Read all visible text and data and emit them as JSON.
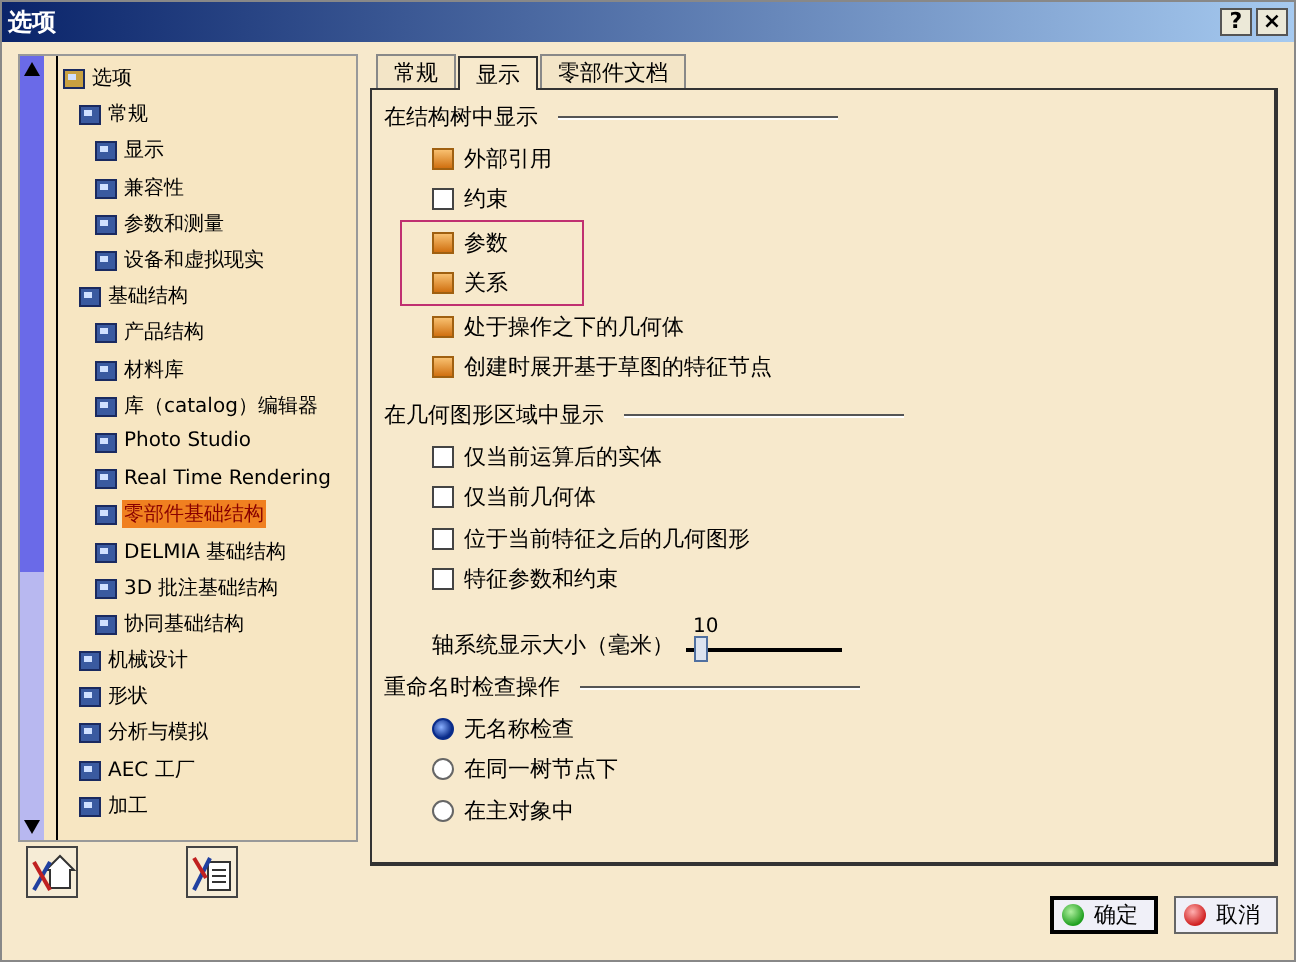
{
  "window": {
    "title": "选项",
    "help_button": "?",
    "close_button": "×"
  },
  "tree": [
    {
      "label": "选项",
      "selected": false,
      "children": [
        {
          "label": "常规",
          "selected": false,
          "children": [
            {
              "label": "显示",
              "selected": false
            },
            {
              "label": "兼容性",
              "selected": false
            },
            {
              "label": "参数和测量",
              "selected": false
            },
            {
              "label": "设备和虚拟现实",
              "selected": false
            }
          ]
        },
        {
          "label": "基础结构",
          "selected": false,
          "children": [
            {
              "label": "产品结构",
              "selected": false
            },
            {
              "label": "材料库",
              "selected": false
            },
            {
              "label": "库（catalog）编辑器",
              "selected": false
            },
            {
              "label": "Photo Studio",
              "selected": false
            },
            {
              "label": "Real Time Rendering",
              "selected": false
            },
            {
              "label": "零部件基础结构",
              "selected": true
            },
            {
              "label": "DELMIA 基础结构",
              "selected": false
            },
            {
              "label": "3D 批注基础结构",
              "selected": false
            },
            {
              "label": "协同基础结构",
              "selected": false
            }
          ]
        },
        {
          "label": "机械设计",
          "selected": false
        },
        {
          "label": "形状",
          "selected": false
        },
        {
          "label": "分析与模拟",
          "selected": false
        },
        {
          "label": "AEC 工厂",
          "selected": false
        },
        {
          "label": "加工",
          "selected": false
        }
      ]
    }
  ],
  "tabs": [
    {
      "label": "常规",
      "selected": false
    },
    {
      "label": "显示",
      "selected": true
    },
    {
      "label": "零部件文档",
      "selected": false
    }
  ],
  "sections": [
    {
      "title": "在结构树中显示",
      "items": [
        {
          "kind": "checkbox",
          "label": "外部引用",
          "checked": true
        },
        {
          "kind": "checkbox",
          "label": "约束",
          "checked": false
        },
        {
          "kind": "highlight",
          "items": [
            {
              "kind": "checkbox",
              "label": "参数",
              "checked": true
            },
            {
              "kind": "checkbox",
              "label": "关系",
              "checked": true
            }
          ]
        },
        {
          "kind": "checkbox",
          "label": "处于操作之下的几何体",
          "checked": true
        },
        {
          "kind": "checkbox",
          "label": "创建时展开基于草图的特征节点",
          "checked": true
        }
      ]
    },
    {
      "title": "在几何图形区域中显示",
      "items": [
        {
          "kind": "checkbox",
          "label": "仅当前运算后的实体",
          "checked": false
        },
        {
          "kind": "checkbox",
          "label": "仅当前几何体",
          "checked": false
        },
        {
          "kind": "checkbox",
          "label": "位于当前特征之后的几何图形",
          "checked": false
        },
        {
          "kind": "checkbox",
          "label": "特征参数和约束",
          "checked": false
        },
        {
          "kind": "slider",
          "label": "轴系统显示大小（毫米）",
          "value": "10",
          "level": 0.05
        }
      ]
    },
    {
      "title": "重命名时检查操作",
      "items": [
        {
          "kind": "radio",
          "label": "无名称检查",
          "selected": true
        },
        {
          "kind": "radio",
          "label": "在同一树节点下",
          "selected": false
        },
        {
          "kind": "radio",
          "label": "在主对象中",
          "selected": false
        }
      ]
    }
  ],
  "buttons": [
    {
      "kind": "ok",
      "label": "确定"
    },
    {
      "kind": "cancel",
      "label": "取消"
    }
  ]
}
